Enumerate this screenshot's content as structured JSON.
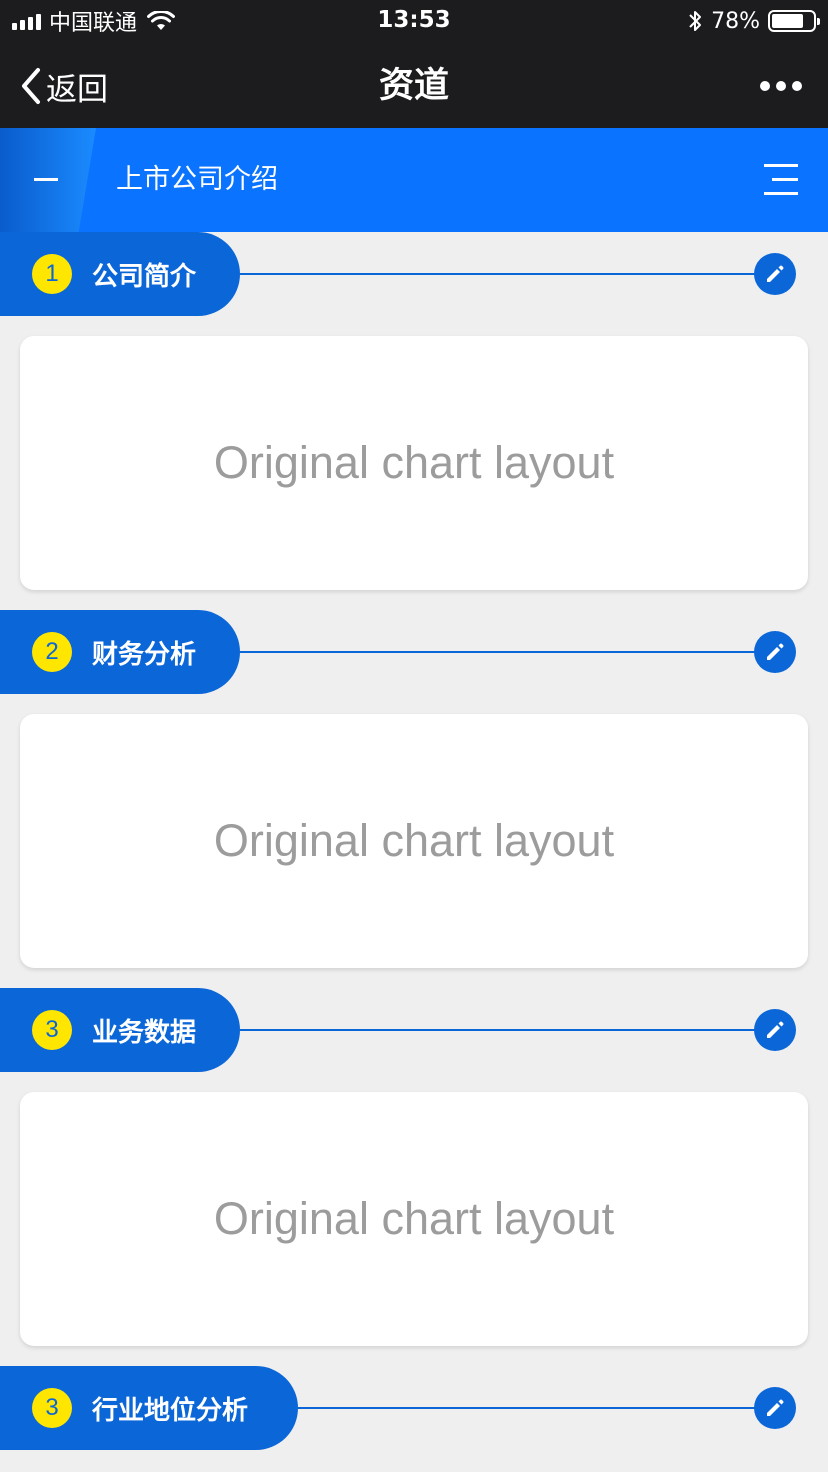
{
  "status_bar": {
    "carrier": "中国联通",
    "time": "13:53",
    "battery": "78%",
    "battery_level": 0.78
  },
  "nav": {
    "back_label": "返回",
    "title": "资道"
  },
  "header": {
    "title": "上市公司介绍"
  },
  "sections": [
    {
      "number": "1",
      "label": "公司简介",
      "placeholder": "Original chart layout"
    },
    {
      "number": "2",
      "label": "财务分析",
      "placeholder": "Original chart layout"
    },
    {
      "number": "3",
      "label": "业务数据",
      "placeholder": "Original chart layout"
    },
    {
      "number": "3",
      "label": "行业地位分析"
    }
  ],
  "colors": {
    "accent": "#0a73ff",
    "section_blue": "#0b66d8",
    "badge_yellow": "#ffe600"
  }
}
